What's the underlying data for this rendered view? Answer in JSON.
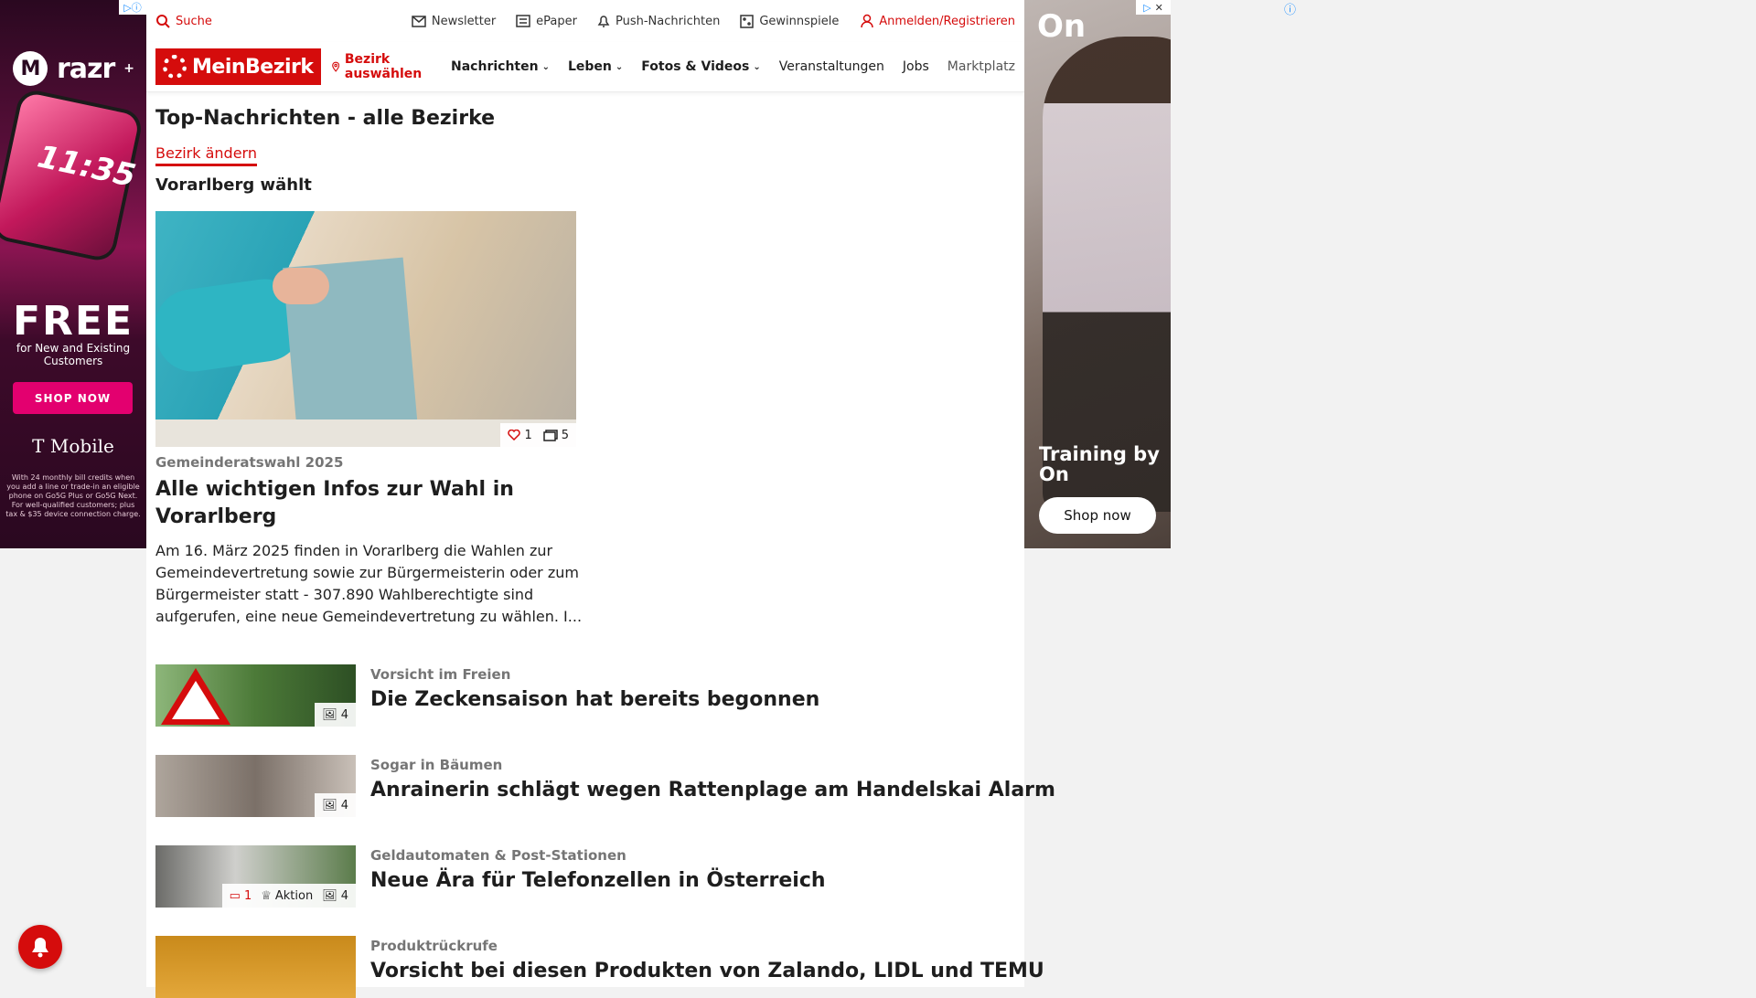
{
  "utility": {
    "search": "Suche",
    "newsletter": "Newsletter",
    "epaper": "ePaper",
    "push": "Push-Nachrichten",
    "gewinnspiele": "Gewinnspiele",
    "login": "Anmelden/Registrieren"
  },
  "nav": {
    "logo": "MeinBezirk",
    "bezirk": "Bezirk auswählen",
    "items": [
      "Nachrichten",
      "Leben",
      "Fotos & Videos",
      "Veranstaltungen",
      "Jobs",
      "Marktplatz"
    ]
  },
  "page": {
    "title": "Top-Nachrichten - alle Bezirke",
    "change": "Bezirk ändern",
    "section": "Vorarlberg wählt"
  },
  "hero": {
    "likes": "1",
    "images": "5",
    "kicker": "Gemeinderatswahl 2025",
    "title": "Alle wichtigen Infos zur Wahl in Vorarlberg",
    "text": "Am 16. März 2025 finden in Vorarlberg die Wahlen zur Gemeindevertretung sowie zur Bürgermeisterin oder zum Bürgermeister statt - 307.890 Wahlberechtigte sind aufgerufen, eine neue Gemeindevertretung zu wählen. I..."
  },
  "articles": [
    {
      "kicker": "Vorsicht im Freien",
      "title": "Die Zeckensaison hat bereits begonnen",
      "images": "4"
    },
    {
      "kicker": "Sogar in Bäumen",
      "title": "Anrainerin schlägt wegen Rattenplage am Handelskai Alarm",
      "images": "4"
    },
    {
      "kicker": "Geldautomaten & Post-Stationen",
      "title": "Neue Ära für Telefonzellen in Österreich",
      "images": "4",
      "comments": "1",
      "aktion": "Aktion"
    },
    {
      "kicker": "Produktrückrufe",
      "title": "Vorsicht bei diesen Produkten von Zalando, LIDL und TEMU"
    }
  ],
  "ad_left": {
    "brand": "razr",
    "clock": "11:35",
    "free": "FREE",
    "free_sub": "for New and Existing Customers",
    "shop": "SHOP NOW",
    "carrier": "T Mobile",
    "fine": "With 24 monthly bill credits when you add a line or trade-in an eligible phone on Go5G Plus or Go5G Next. For well-qualified customers; plus tax & $35 device connection charge."
  },
  "ad_right": {
    "logo": "On",
    "headline": "Training by On",
    "cta": "Shop now"
  },
  "colors": {
    "brand_red": "#d50c0c",
    "kicker_gray": "#757575"
  }
}
